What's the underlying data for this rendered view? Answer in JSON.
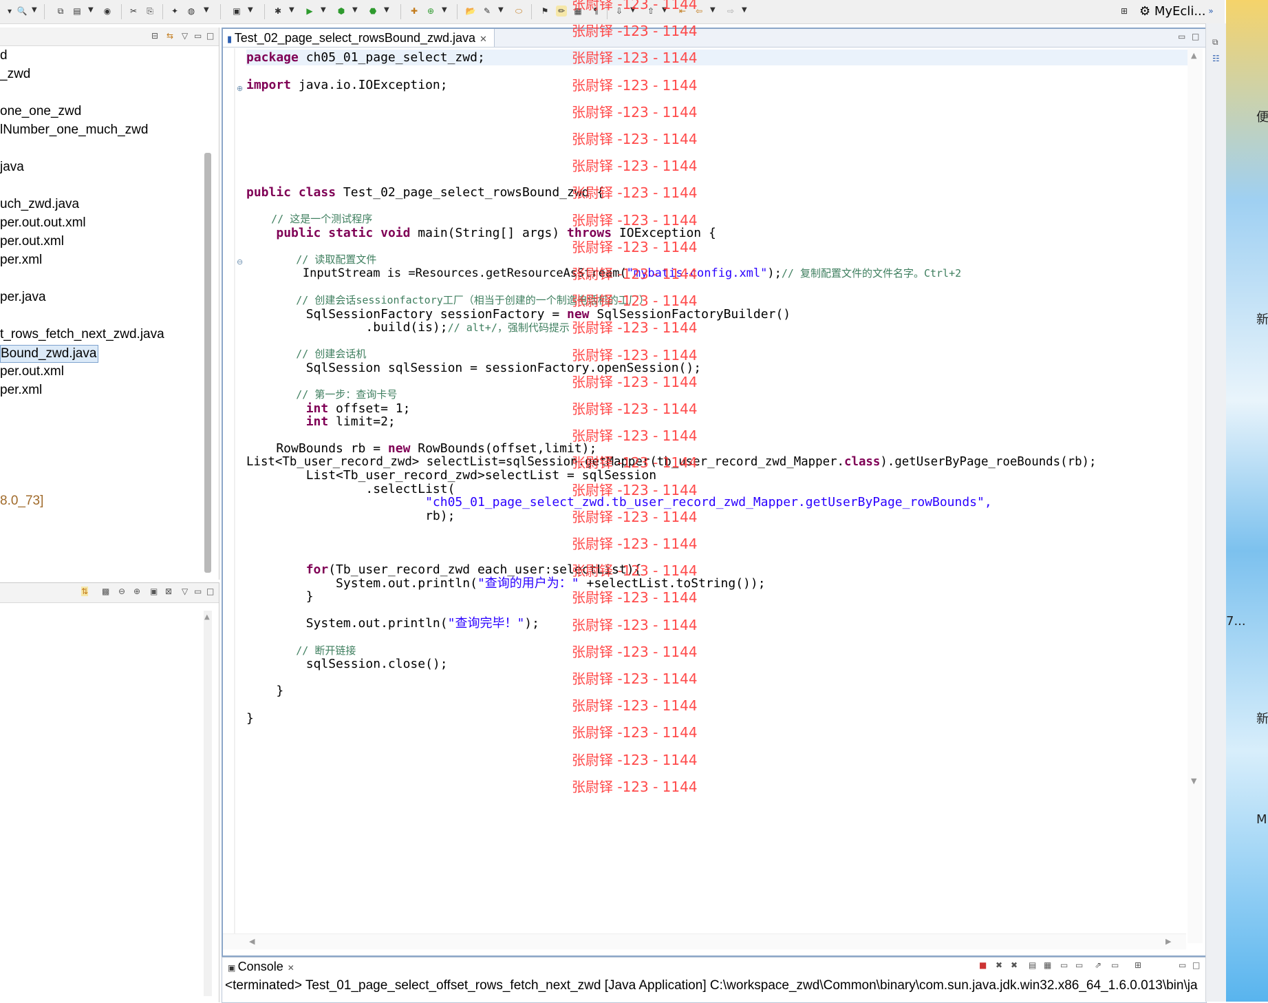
{
  "toolbar": {
    "perspective_label": "MyEcli..."
  },
  "explorer": {
    "items": [
      {
        "label": "d"
      },
      {
        "label": "_zwd"
      },
      {
        "label": "one_one_zwd"
      },
      {
        "label": "lNumber_one_much_zwd"
      },
      {
        "label": "java"
      },
      {
        "label": "uch_zwd.java"
      },
      {
        "label": "per.out.out.xml"
      },
      {
        "label": "per.out.xml"
      },
      {
        "label": "per.xml"
      },
      {
        "label": "per.java"
      },
      {
        "label": "t_rows_fetch_next_zwd.java"
      },
      {
        "label": "Bound_zwd.java"
      },
      {
        "label": "per.out.xml"
      },
      {
        "label": "per.xml"
      },
      {
        "label": "8.0_73]"
      }
    ],
    "selected_index": 11
  },
  "editor": {
    "tab_label": "Test_02_page_select_rowsBound_zwd.java",
    "lines": [
      "package ch05_01_page_select_zwd;",
      "import java.io.IOException;",
      "public class Test_02_page_select_rowsBound_zwd {",
      "    // 这是一个测试程序",
      "    public static void main(String[] args) throws IOException {",
      "        // 读取配置文件",
      "        InputStream is =Resources.getResourceAsStream(\"mybatis-config.xml\");// 复制配置文件的文件名字。Ctrl+2",
      "        // 创建会话sessionfactory工厂（相当于创建的一个制造电话机的工厂）",
      "        SqlSessionFactory sessionFactory = new SqlSessionFactoryBuilder()",
      "                .build(is);// alt+/，强制代码提示",
      "        // 创建会话机",
      "        SqlSession sqlSession = sessionFactory.openSession();",
      "        // 第一步：查询卡号",
      "        int offset= 1;",
      "        int limit=2;",
      "    RowBounds rb = new RowBounds(offset,limit);",
      "List<Tb_user_record_zwd> selectList=sqlSession.getMapper(tb_user_record_zwd_Mapper.class).getUserByPage_roeBounds(rb);",
      "        List<Tb_user_record_zwd>selectList = sqlSession",
      "                .selectList(",
      "                        \"ch05_01_page_select_zwd.tb_user_record_zwd_Mapper.getUserByPage_rowBounds\",",
      "                        rb);",
      "        for(Tb_user_record_zwd each_user:selectList){",
      "            System.out.println(\"查询的用户为：\" +selectList.toString());",
      "        }",
      "        System.out.println(\"查询完毕！\");",
      "        // 断开链接",
      "        sqlSession.close();",
      "    }",
      "}"
    ]
  },
  "watermark": {
    "text": "张尉铎 -123 - 1144",
    "color": "#ff3b3b",
    "count": 30
  },
  "console": {
    "tab_label": "Console",
    "status": "<terminated> Test_01_page_select_offset_rows_fetch_next_zwd [Java Application] C:\\workspace_zwd\\Common\\binary\\com.sun.java.jdk.win32.x86_64_1.6.0.013\\bin\\ja"
  },
  "desktop": {
    "labels": [
      "便",
      "新",
      "7...",
      "新",
      "M"
    ]
  }
}
